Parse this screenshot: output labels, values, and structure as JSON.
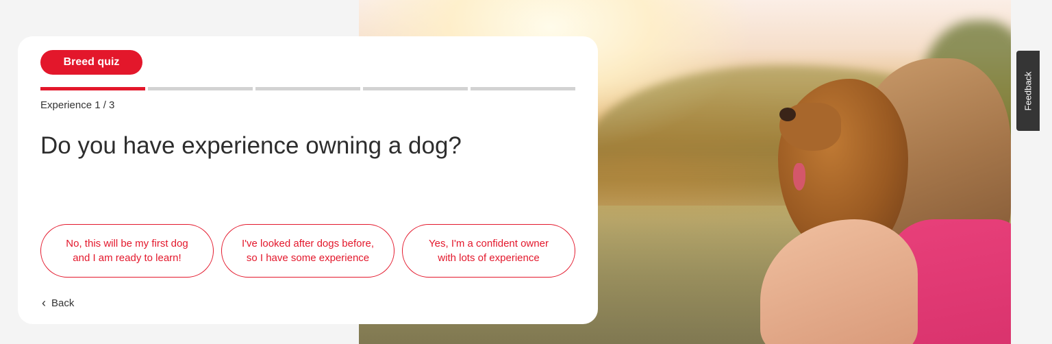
{
  "quiz": {
    "badge_label": "Breed quiz",
    "progress": {
      "total_segments": 5,
      "active_segments": 1
    },
    "step_label": "Experience 1 / 3",
    "question": "Do you have experience owning a dog?",
    "answers": [
      {
        "label": "No, this will be my first dog\nand I am ready to learn!"
      },
      {
        "label": "I've looked after dogs before,\nso I have some experience"
      },
      {
        "label": "Yes, I'm a confident owner\nwith lots of experience"
      }
    ],
    "back_label": "Back",
    "back_icon": "chevron-left-icon"
  },
  "feedback": {
    "label": "Feedback"
  },
  "hero": {
    "image_subject": "woman kissing golden retriever in sunlit field"
  },
  "colors": {
    "accent": "#e3172b",
    "progress_track": "#d2d2d2",
    "feedback_tab": "#353535",
    "card_background": "#ffffff",
    "page_background": "#f4f4f4"
  }
}
